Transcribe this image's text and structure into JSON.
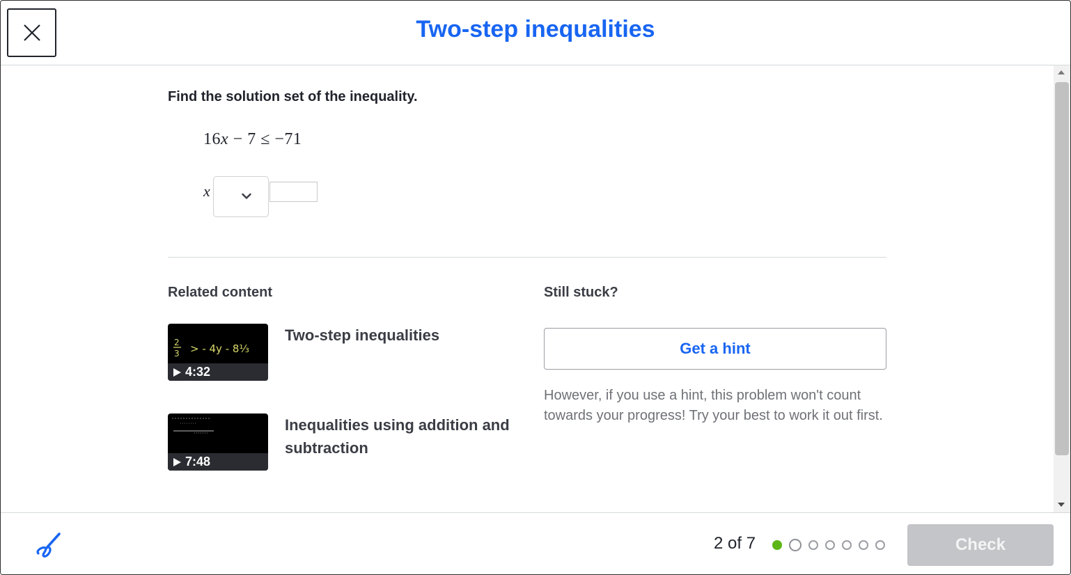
{
  "header": {
    "title": "Two-step inequalities",
    "close_icon": "close-icon"
  },
  "question": {
    "prompt": "Find the solution set of the inequality.",
    "equation": {
      "coef": "16",
      "var": "x",
      "op1": "−",
      "const": "7",
      "rel": "≤",
      "rhs": "−71"
    },
    "answer_var": "x",
    "relation_select_value": "",
    "answer_input_value": ""
  },
  "related": {
    "heading": "Related content",
    "videos": [
      {
        "title": "Two-step inequalities",
        "duration": "4:32",
        "thumb_text_1": "2",
        "thumb_text_2": "3",
        "thumb_text_3": "> - 4y - 8⅓"
      },
      {
        "title": "Inequalities using addition and subtraction",
        "duration": "7:48"
      }
    ]
  },
  "hint": {
    "heading": "Still stuck?",
    "button_label": "Get a hint",
    "note": "However, if you use a hint, this problem won't count towards your progress! Try your best to work it out first."
  },
  "footer": {
    "progress_text": "2 of 7",
    "progress": {
      "current": 2,
      "total": 7,
      "completed": 1
    },
    "check_label": "Check",
    "scratchpad_icon": "scratchpad-pencil-icon"
  },
  "colors": {
    "accent": "#1865f2",
    "done": "#5cb615",
    "check_disabled": "#c4c5c8"
  }
}
